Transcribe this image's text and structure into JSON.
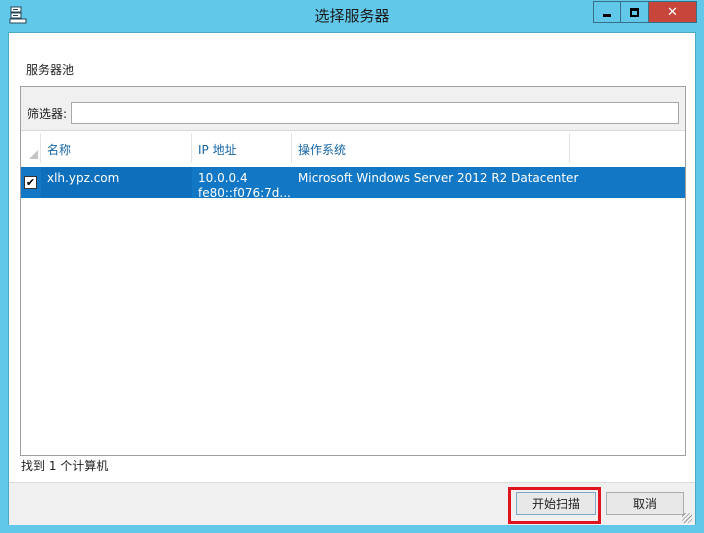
{
  "window": {
    "title": "选择服务器",
    "controls": {
      "minimize": "minimize-icon",
      "maximize": "maximize-icon",
      "close": "close-icon"
    }
  },
  "pool": {
    "label": "服务器池",
    "filter": {
      "label": "筛选器:",
      "value": ""
    },
    "columns": {
      "name": "名称",
      "ip": "IP 地址",
      "os": "操作系统"
    },
    "rows": [
      {
        "checked": true,
        "name": "xlh.ypz.com",
        "ip_line1": "10.0.0.4",
        "ip_line2": "fe80::f076:7d...",
        "os": "Microsoft Windows Server 2012 R2 Datacenter"
      }
    ]
  },
  "status": {
    "found_text": "找到 1 个计算机"
  },
  "buttons": {
    "scan": "开始扫描",
    "cancel": "取消"
  },
  "colors": {
    "titlebar": "#62c8ea",
    "close_button": "#c7453a",
    "row_selected": "#1278c6",
    "header_text": "#1565a6",
    "highlight_box": "#e0141e"
  }
}
